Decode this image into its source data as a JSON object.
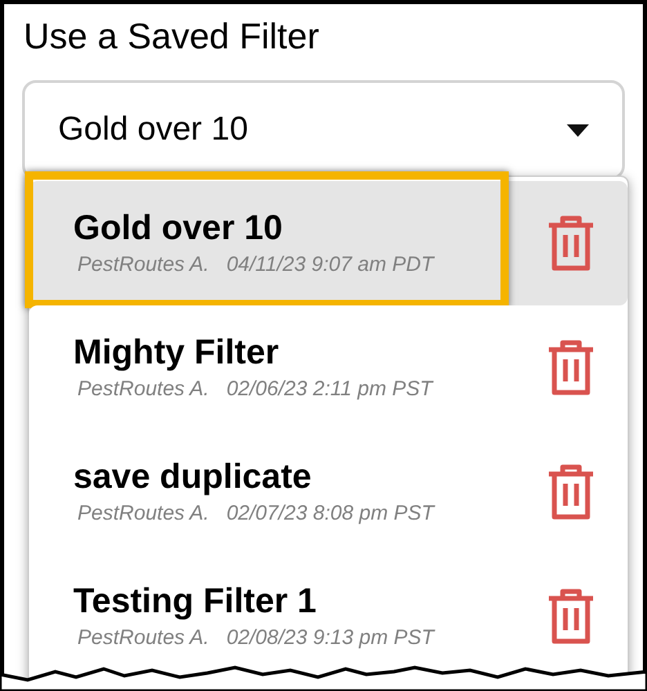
{
  "title": "Use a Saved Filter",
  "select": {
    "value": "Gold over 10"
  },
  "options": [
    {
      "name": "Gold over 10",
      "author": "PestRoutes A.",
      "date": "04/11/23 9:07 am PDT",
      "selected": true,
      "highlighted": true
    },
    {
      "name": "Mighty Filter",
      "author": "PestRoutes A.",
      "date": "02/06/23 2:11 pm PST",
      "selected": false,
      "highlighted": false
    },
    {
      "name": "save duplicate",
      "author": "PestRoutes A.",
      "date": "02/07/23 8:08 pm PST",
      "selected": false,
      "highlighted": false
    },
    {
      "name": "Testing Filter 1",
      "author": "PestRoutes A.",
      "date": "02/08/23 9:13 pm PST",
      "selected": false,
      "highlighted": false
    }
  ]
}
